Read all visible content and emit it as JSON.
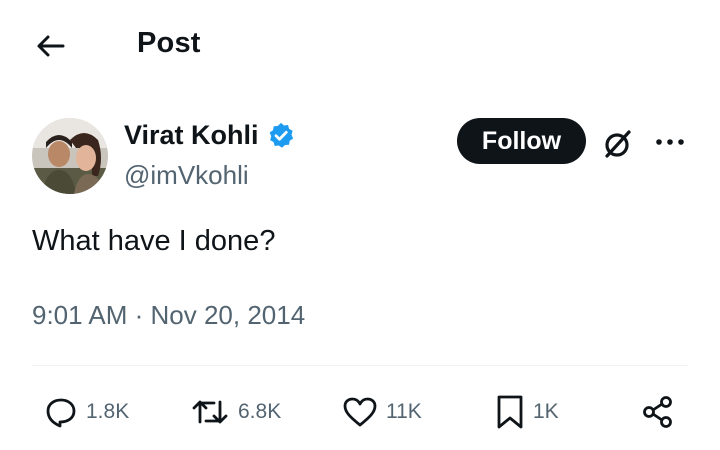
{
  "header": {
    "back_icon": "arrow-left-icon",
    "title": "Post"
  },
  "tweet": {
    "author": {
      "name": "Virat Kohli",
      "handle": "@imVkohli",
      "verified": true,
      "verified_color": "#1d9bf0"
    },
    "follow_label": "Follow",
    "grok_icon": "grok-icon",
    "more_icon": "more-options-icon",
    "text": "What have I done?",
    "timestamp": "9:01 AM · Nov 20, 2014"
  },
  "actions": {
    "reply": {
      "icon": "reply-icon",
      "count": "1.8K"
    },
    "repost": {
      "icon": "repost-icon",
      "count": "6.8K"
    },
    "like": {
      "icon": "heart-icon",
      "count": "11K"
    },
    "bookmark": {
      "icon": "bookmark-icon",
      "count": "1K"
    },
    "share": {
      "icon": "share-icon"
    }
  },
  "colors": {
    "text_primary": "#0f1419",
    "text_secondary": "#536471",
    "button_dark": "#0f1419",
    "divider": "#eff3f4"
  }
}
